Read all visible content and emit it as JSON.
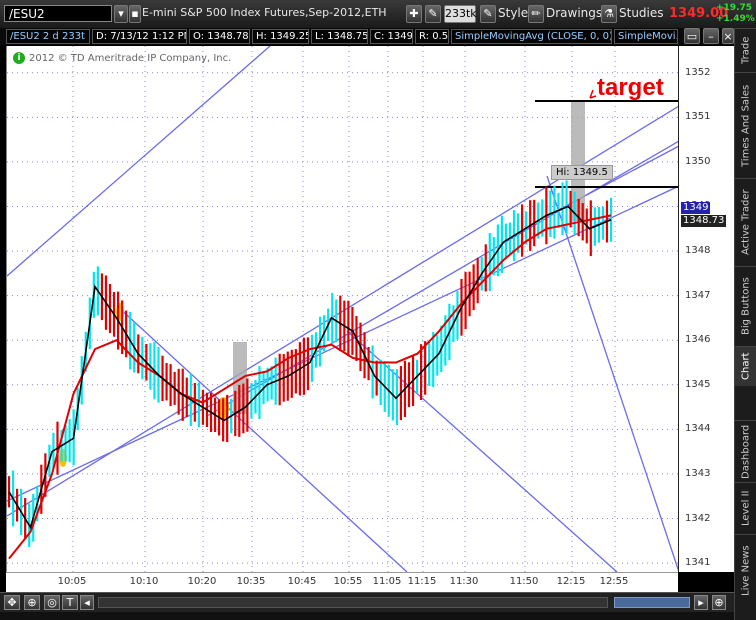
{
  "toolbar": {
    "symbol": "/ESU2",
    "title": "E-mini S&P 500 Index Futures,Sep-2012,ETH",
    "aggregation": "233tk",
    "style_label": "Style",
    "drawings_label": "Drawings",
    "studies_label": "Studies",
    "last_price": "1349.00",
    "change_points": "+19.75",
    "change_percent": "+1.49%"
  },
  "infobar": {
    "symbol_agg": "/ESU2 2 d 233t",
    "date": "D: 7/13/12 1:12 PM",
    "open": "O: 1348.78",
    "high": "H: 1349.25",
    "low": "L: 1348.75",
    "close": "C: 1349",
    "range": "R: 0.5",
    "study1": "SimpleMovingAvg (CLOSE, 0, 0)",
    "study2": "SimpleMovi..."
  },
  "chart": {
    "copyright": "2012 © TD Ameritrade IP Company, Inc.",
    "hi_label": "Hi: 1349.5",
    "target_label": "target",
    "price_tag_last": "1349",
    "price_tag_ma": "1348.73",
    "colors": {
      "bar_up": "#00e5ee",
      "bar_down": "#e00000",
      "ma_fast": "#000000",
      "ma_slow": "#e00000",
      "trendline": "#6a6aee",
      "grid": "#8888dd"
    }
  },
  "sidebar": {
    "tabs": [
      "Trade",
      "Times And Sales",
      "Active Trader",
      "Big Buttons",
      "Chart",
      "Dashboard",
      "Level II",
      "Live News"
    ],
    "active": "Chart"
  },
  "chart_data": {
    "type": "line",
    "title": "",
    "xlabel": "",
    "ylabel": "",
    "ylim": [
      1340.8,
      1352.6
    ],
    "y_ticks": [
      "1352",
      "1351",
      "1350",
      "1349",
      "1348",
      "1347",
      "1346",
      "1345",
      "1344",
      "1343",
      "1342",
      "1341"
    ],
    "x_ticks": [
      "10:05",
      "10:10",
      "10:20",
      "10:35",
      "10:45",
      "10:55",
      "11:05",
      "11:15",
      "11:30",
      "11:50",
      "12:15",
      "12:55"
    ],
    "grid": true,
    "series": [
      {
        "values": [
          1342.6,
          1341.8,
          1343.5,
          1343.8,
          1347.2,
          1346.5,
          1345.7,
          1345.2,
          1344.8,
          1344.5,
          1344.2,
          1344.5,
          1345.0,
          1345.2,
          1345.5,
          1346.5,
          1346.2,
          1345.2,
          1344.7,
          1345.2,
          1345.7,
          1346.7,
          1347.5,
          1348.2,
          1348.5,
          1348.8,
          1349.0,
          1348.5,
          1348.7
        ]
      },
      {
        "values": [
          1341.1,
          1341.7,
          1343.0,
          1344.8,
          1345.8,
          1346.0,
          1345.5,
          1345.2,
          1344.8,
          1344.6,
          1344.9,
          1345.2,
          1345.3,
          1345.6,
          1345.8,
          1345.9,
          1345.6,
          1345.5,
          1345.5,
          1345.7,
          1346.2,
          1346.8,
          1347.3,
          1347.8,
          1348.2,
          1348.5,
          1348.6,
          1348.7,
          1348.8
        ]
      }
    ],
    "annotations": [
      "target",
      "Hi: 1349.5"
    ]
  }
}
